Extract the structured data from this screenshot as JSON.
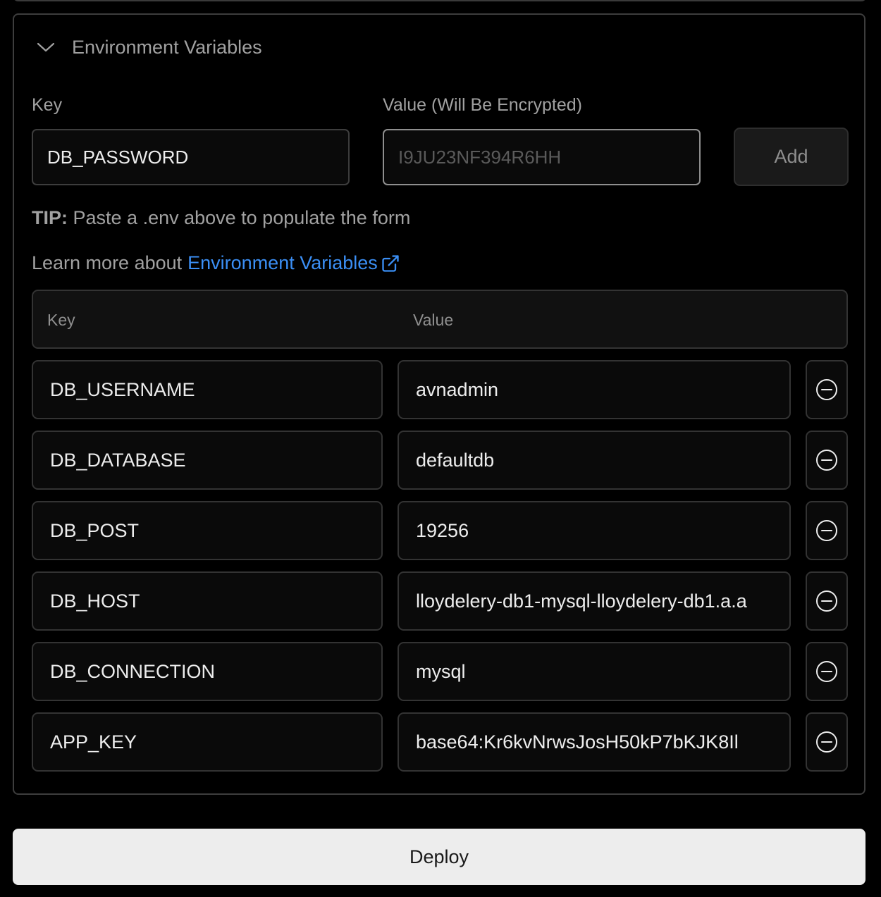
{
  "section": {
    "title": "Environment Variables"
  },
  "form": {
    "key_label": "Key",
    "value_label": "Value (Will Be Encrypted)",
    "key_value": "DB_PASSWORD",
    "value_placeholder": "I9JU23NF394R6HH",
    "add_label": "Add"
  },
  "tip": {
    "prefix": "TIP:",
    "text": " Paste a .env above to populate the form"
  },
  "learn": {
    "text": "Learn more about",
    "link": "Environment Variables"
  },
  "table": {
    "key_header": "Key",
    "value_header": "Value",
    "rows": [
      {
        "key": "DB_USERNAME",
        "value": "avnadmin"
      },
      {
        "key": "DB_DATABASE",
        "value": "defaultdb"
      },
      {
        "key": "DB_POST",
        "value": "19256"
      },
      {
        "key": "DB_HOST",
        "value": "lloydelery-db1-mysql-lloydelery-db1.a.a"
      },
      {
        "key": "DB_CONNECTION",
        "value": "mysql"
      },
      {
        "key": "APP_KEY",
        "value": "base64:Kr6kvNrwsJosH50kP7bKJK8Il"
      }
    ]
  },
  "deploy_label": "Deploy",
  "colors": {
    "background": "#000000",
    "border": "#3d3d3d",
    "link": "#3b8ff5",
    "deploy_bg": "#ededed"
  }
}
